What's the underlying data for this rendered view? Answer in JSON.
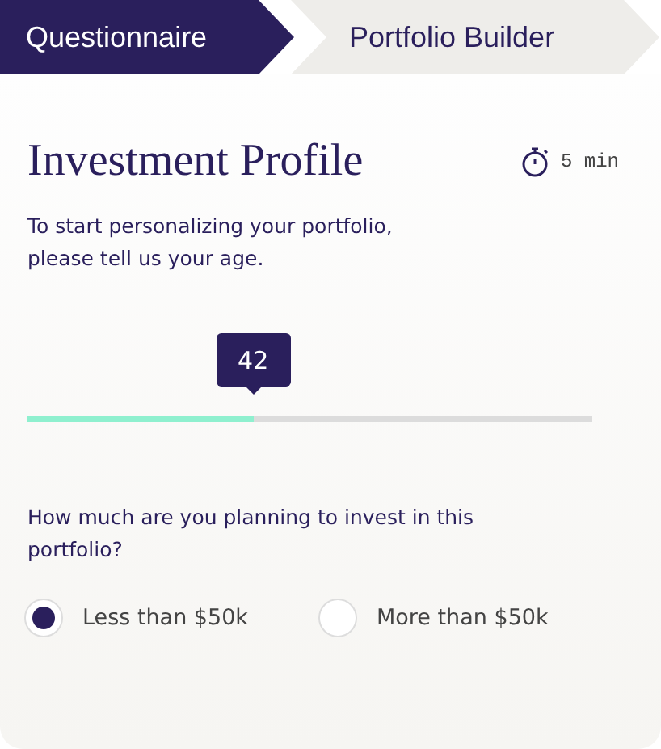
{
  "steps": [
    {
      "label": "Questionnaire",
      "selected": true
    },
    {
      "label": "Portfolio Builder",
      "selected": false
    }
  ],
  "title": "Investment Profile",
  "duration": "5 min",
  "age_prompt": "To start personalizing your portfolio, please tell us your age.",
  "age_slider": {
    "value": "42",
    "level": 0.4
  },
  "amount_question": "How much are you planning to invest in this portfolio?",
  "amount_options": [
    {
      "label": "Less than $50k",
      "selected": true
    },
    {
      "label": "More than $50k",
      "selected": false
    }
  ]
}
